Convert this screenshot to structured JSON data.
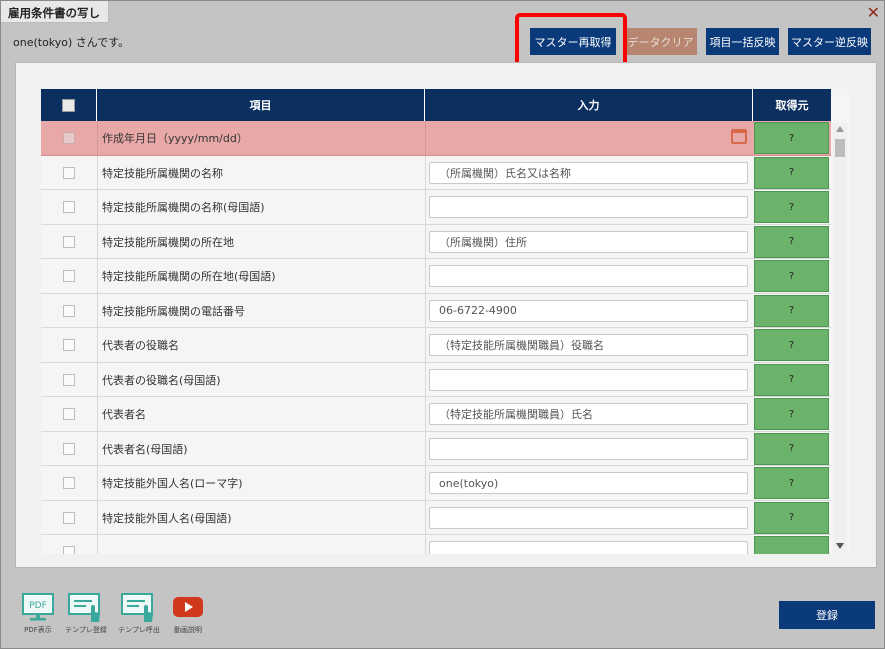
{
  "dialog": {
    "title": "雇用条件書の写し",
    "greeting": "one(tokyo) さんです。"
  },
  "toolbar": {
    "master_refetch": "マスター再取得",
    "data_clear": "データクリア",
    "bulk_reflect": "項目一括反映",
    "master_reverse": "マスター逆反映"
  },
  "table": {
    "headers": {
      "item": "項目",
      "input": "入力",
      "source": "取得元"
    },
    "rows": [
      {
        "label": "作成年月日（yyyy/mm/dd）",
        "value": "",
        "source": "?"
      },
      {
        "label": "特定技能所属機関の名称",
        "value": "（所属機関）氏名又は名称",
        "source": "?"
      },
      {
        "label": "特定技能所属機関の名称(母国語)",
        "value": "",
        "source": "?"
      },
      {
        "label": "特定技能所属機関の所在地",
        "value": "（所属機関）住所",
        "source": "?"
      },
      {
        "label": "特定技能所属機関の所在地(母国語)",
        "value": "",
        "source": "?"
      },
      {
        "label": "特定技能所属機関の電話番号",
        "value": "06-6722-4900",
        "source": "?"
      },
      {
        "label": "代表者の役職名",
        "value": "（特定技能所属機関職員）役職名",
        "source": "?"
      },
      {
        "label": "代表者の役職名(母国語)",
        "value": "",
        "source": "?"
      },
      {
        "label": "代表者名",
        "value": "（特定技能所属機関職員）氏名",
        "source": "?"
      },
      {
        "label": "代表者名(母国語)",
        "value": "",
        "source": "?"
      },
      {
        "label": "特定技能外国人名(ローマ字)",
        "value": "one(tokyo)",
        "source": "?"
      },
      {
        "label": "特定技能外国人名(母国語)",
        "value": "",
        "source": "?"
      },
      {
        "label": "",
        "value": "",
        "source": ""
      }
    ]
  },
  "footer": {
    "pdf_icon_text": "PDF",
    "pdf_caption": "PDF表示",
    "template_save": "テンプレ登録",
    "template_load": "テンプレ呼出",
    "video_caption": "動画説明",
    "register": "登録"
  },
  "colors": {
    "primary": "#0a3a7a",
    "header": "#0b2f5e",
    "highlight_row": "#e8a8a8",
    "source_cell": "#6bb36b",
    "callout": "#ff0000"
  }
}
